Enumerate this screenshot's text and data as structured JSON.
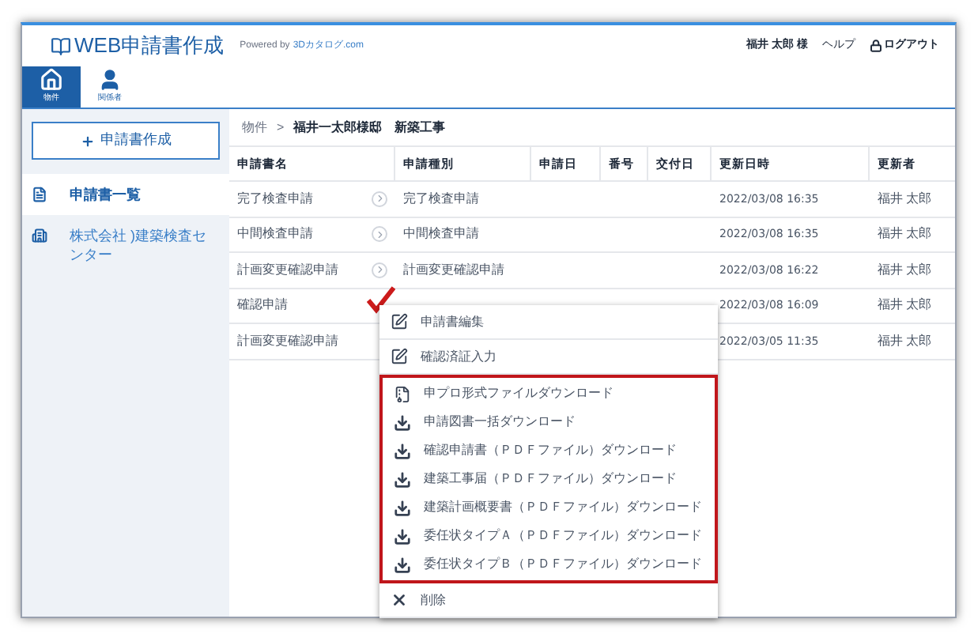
{
  "header": {
    "logo": "WEB申請書作成",
    "powered_by": "Powered by",
    "powered_link": "3Dカタログ.com",
    "user": "福井 太郎 様",
    "help": "ヘルプ",
    "logout": "ログアウト"
  },
  "nav_tabs": [
    {
      "label": "物件",
      "kind": "home",
      "selected": true
    },
    {
      "label": "関係者",
      "kind": "person",
      "selected": false
    }
  ],
  "sidebar": {
    "create_button": "申請書作成",
    "items": [
      {
        "label": "申請書一覧",
        "kind": "list",
        "selected": true
      },
      {
        "label": "株式会社 )建築検査センター",
        "kind": "org",
        "selected": false
      }
    ]
  },
  "breadcrumb": {
    "root": "物件",
    "separator": ">",
    "current": "福井一太郎様邸　新築工事"
  },
  "table": {
    "columns": [
      "申請書名",
      "申請種別",
      "申請日",
      "番号",
      "交付日",
      "更新日時",
      "更新者"
    ],
    "rows": [
      {
        "cells": [
          "完了検査申請",
          "完了検査申請",
          "",
          "",
          "",
          "2022/03/08 16:35",
          "福井 太郎"
        ],
        "chevron": true
      },
      {
        "cells": [
          "中間検査申請",
          "中間検査申請",
          "",
          "",
          "",
          "2022/03/08 16:35",
          "福井 太郎"
        ],
        "chevron": true
      },
      {
        "cells": [
          "計画変更確認申請",
          "計画変更確認申請",
          "",
          "",
          "",
          "2022/03/08 16:22",
          "福井 太郎"
        ],
        "chevron": true
      },
      {
        "cells": [
          "確認申請",
          "",
          "",
          "",
          "",
          "2022/03/08 16:09",
          "福井 太郎"
        ],
        "chevron": false
      },
      {
        "cells": [
          "計画変更確認申請",
          "",
          "",
          "",
          "",
          "2022/03/05 11:35",
          "福井 太郎"
        ],
        "chevron": false
      }
    ]
  },
  "context_menu": {
    "items": [
      {
        "label": "申請書編集",
        "kind": "edit",
        "highlighted": false
      },
      {
        "label": "確認済証入力",
        "kind": "edit",
        "highlighted": false
      },
      {
        "label": "申プロ形式ファイルダウンロード",
        "kind": "file",
        "highlighted": true
      },
      {
        "label": "申請図書一括ダウンロード",
        "kind": "download",
        "highlighted": true
      },
      {
        "label": "確認申請書（ＰＤＦファイル）ダウンロード",
        "kind": "download",
        "highlighted": true
      },
      {
        "label": "建築工事届（ＰＤＦファイル）ダウンロード",
        "kind": "download",
        "highlighted": true
      },
      {
        "label": "建築計画概要書（ＰＤＦファイル）ダウンロード",
        "kind": "download",
        "highlighted": true
      },
      {
        "label": "委任状タイプＡ（ＰＤＦファイル）ダウンロード",
        "kind": "download",
        "highlighted": true
      },
      {
        "label": "委任状タイプＢ（ＰＤＦファイル）ダウンロード",
        "kind": "download",
        "highlighted": true
      },
      {
        "label": "削除",
        "kind": "delete",
        "highlighted": false
      }
    ]
  }
}
